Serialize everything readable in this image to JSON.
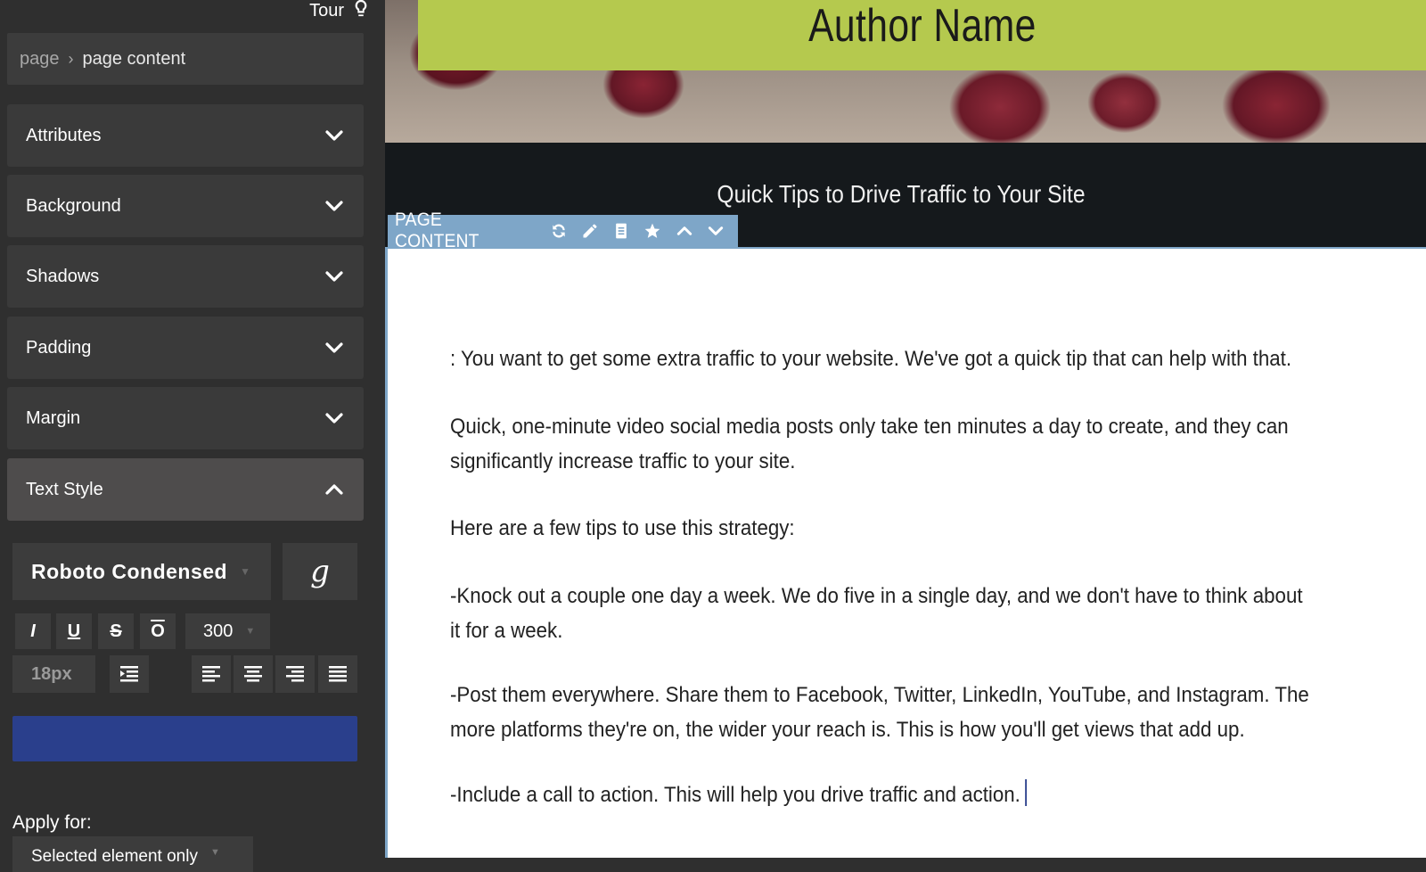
{
  "sidebar": {
    "tour_label": "Tour",
    "breadcrumb": {
      "root": "page",
      "current": "page content"
    },
    "sections": [
      {
        "label": "Attributes",
        "expanded": false
      },
      {
        "label": "Background",
        "expanded": false
      },
      {
        "label": "Shadows",
        "expanded": false
      },
      {
        "label": "Padding",
        "expanded": false
      },
      {
        "label": "Margin",
        "expanded": false
      },
      {
        "label": "Text Style",
        "expanded": true
      }
    ],
    "text_style": {
      "font_family": "Roboto Condensed",
      "google_fonts_glyph": "g",
      "italic_label": "I",
      "underline_label": "U",
      "strike_label": "S",
      "overline_label": "O",
      "font_weight": "300",
      "font_size": "18px",
      "color": "#2a3f8c"
    },
    "apply_for": {
      "label": "Apply for:",
      "value": "Selected element only"
    }
  },
  "page": {
    "author_name": "Author Name",
    "tagline": "Quick Tips to Drive Traffic to Your Site",
    "banner_color": "#b5c94e",
    "toolbar_label": "PAGE CONTENT",
    "paragraphs": [
      ": You want to get some extra traffic to your website. We've got a quick tip that can help with that.",
      "Quick, one-minute video social media posts only take ten minutes a day to create, and they can significantly increase traffic to your site.",
      "Here are a few tips to use this strategy:",
      "-Knock out a couple one day a week. We do five in a single day, and we don't have to think about it for a week.",
      "-Post them everywhere. Share them to Facebook, Twitter, LinkedIn, YouTube, and Instagram. The more platforms they're on, the wider your reach is. This is how you'll get views that add up.",
      "-Include a call to action. This will help you drive traffic and action."
    ]
  }
}
